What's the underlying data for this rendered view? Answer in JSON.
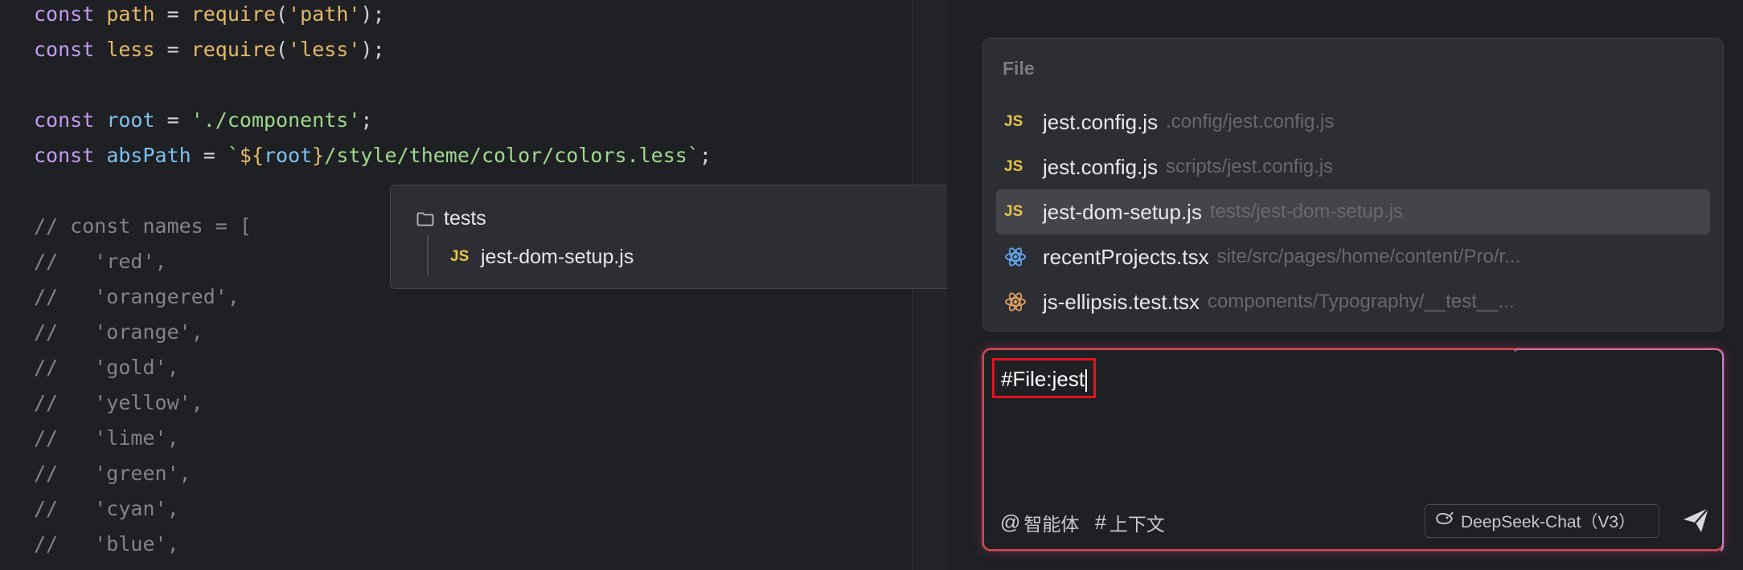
{
  "editor": {
    "lines": [
      [
        {
          "t": "const ",
          "c": "kw"
        },
        {
          "t": "path",
          "c": "var"
        },
        {
          "t": " = ",
          "c": "fn"
        },
        {
          "t": "require",
          "c": "var"
        },
        {
          "t": "(",
          "c": "fn"
        },
        {
          "t": "'path'",
          "c": "var"
        },
        {
          "t": ");",
          "c": "fn"
        }
      ],
      [
        {
          "t": "const ",
          "c": "kw"
        },
        {
          "t": "less",
          "c": "var"
        },
        {
          "t": " = ",
          "c": "fn"
        },
        {
          "t": "require",
          "c": "var"
        },
        {
          "t": "(",
          "c": "fn"
        },
        {
          "t": "'less'",
          "c": "var"
        },
        {
          "t": ");",
          "c": "fn"
        }
      ],
      [],
      [
        {
          "t": "const ",
          "c": "kw"
        },
        {
          "t": "root",
          "c": "tpl"
        },
        {
          "t": " = ",
          "c": "fn"
        },
        {
          "t": "'./components'",
          "c": "str"
        },
        {
          "t": ";",
          "c": "fn"
        }
      ],
      [
        {
          "t": "const ",
          "c": "kw"
        },
        {
          "t": "absPath",
          "c": "tpl"
        },
        {
          "t": " = ",
          "c": "fn"
        },
        {
          "t": "`",
          "c": "str"
        },
        {
          "t": "${",
          "c": "var"
        },
        {
          "t": "root",
          "c": "tpl"
        },
        {
          "t": "}",
          "c": "var"
        },
        {
          "t": "/style/theme/color/colors.less`",
          "c": "str"
        },
        {
          "t": ";",
          "c": "fn"
        }
      ],
      [],
      [
        {
          "t": "// const names = [",
          "c": "cmt"
        }
      ],
      [
        {
          "t": "//   'red',",
          "c": "cmt"
        }
      ],
      [
        {
          "t": "//   'orangered',",
          "c": "cmt"
        }
      ],
      [
        {
          "t": "//   'orange',",
          "c": "cmt"
        }
      ],
      [
        {
          "t": "//   'gold',",
          "c": "cmt"
        }
      ],
      [
        {
          "t": "//   'yellow',",
          "c": "cmt"
        }
      ],
      [
        {
          "t": "//   'lime',",
          "c": "cmt"
        }
      ],
      [
        {
          "t": "//   'green',",
          "c": "cmt"
        }
      ],
      [
        {
          "t": "//   'cyan',",
          "c": "cmt"
        }
      ],
      [
        {
          "t": "//   'blue',",
          "c": "cmt"
        }
      ]
    ]
  },
  "tree_popup": {
    "folder": "tests",
    "file_badge": "JS",
    "file": "jest-dom-setup.js"
  },
  "suggestions": {
    "header": "File",
    "items": [
      {
        "icon": "js-icon",
        "badge": "JS",
        "name": "jest.config.js",
        "path": ".config/jest.config.js",
        "selected": false
      },
      {
        "icon": "js-icon",
        "badge": "JS",
        "name": "jest.config.js",
        "path": "scripts/jest.config.js",
        "selected": false
      },
      {
        "icon": "js-icon",
        "badge": "JS",
        "name": "jest-dom-setup.js",
        "path": "tests/jest-dom-setup.js",
        "selected": true
      },
      {
        "icon": "react-icon",
        "badge": "",
        "name": "recentProjects.tsx",
        "path": "site/src/pages/home/content/Pro/r...",
        "selected": false
      },
      {
        "icon": "react-icon",
        "badge": "",
        "name": "js-ellipsis.test.tsx",
        "path": "components/Typography/__test__...",
        "selected": false
      }
    ]
  },
  "chat_input": {
    "value": "#File:jest",
    "agent_symbol": "@",
    "agent_label": "智能体",
    "context_symbol": "#",
    "context_label": "上下文",
    "model_label": "DeepSeek-Chat（V3）"
  },
  "colors": {
    "accent_border": "#d44a4a",
    "highlight_box": "#e0141e",
    "js_badge": "#e8c547",
    "react_blue": "#61a8f0",
    "react_orange": "#e0a060"
  }
}
